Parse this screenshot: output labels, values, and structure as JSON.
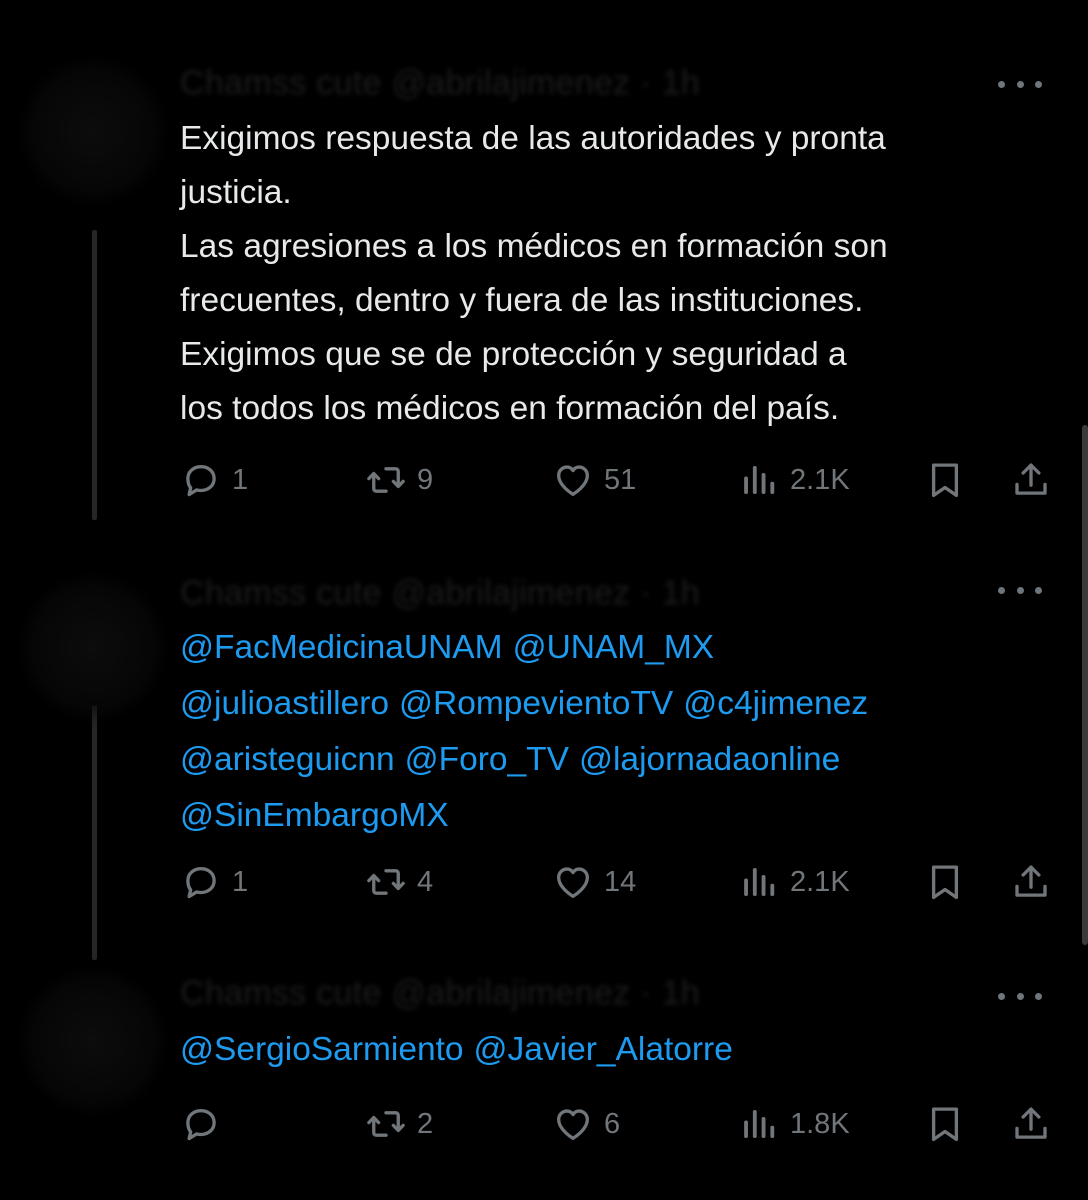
{
  "tweets": [
    {
      "author_line": "Chamss cute @abrilajimenez · 1h",
      "text": "Exigimos respuesta de las autoridades y pronta\njusticia.\nLas agresiones a los médicos en formación son\nfrecuentes, dentro y fuera de las instituciones.\nExigimos que se de protección y seguridad a\nlos todos los médicos en formación del país.",
      "replies": "1",
      "reposts": "9",
      "likes": "51",
      "views": "2.1K"
    },
    {
      "author_line": "Chamss cute @abrilajimenez · 1h",
      "mentions": [
        "@FacMedicinaUNAM",
        "@UNAM_MX",
        "@julioastillero",
        "@RompevientoTV",
        "@c4jimenez",
        "@aristeguicnn",
        "@Foro_TV",
        "@lajornadaonline",
        "@SinEmbargoMX"
      ],
      "replies": "1",
      "reposts": "4",
      "likes": "14",
      "views": "2.1K"
    },
    {
      "author_line": "Chamss cute @abrilajimenez · 1h",
      "mentions": [
        "@SergioSarmiento",
        "@Javier_Alatorre"
      ],
      "replies": "",
      "reposts": "2",
      "likes": "6",
      "views": "1.8K"
    }
  ],
  "icons": {
    "reply": "reply-icon",
    "repost": "repost-icon",
    "like": "heart-icon",
    "views": "views-icon",
    "bookmark": "bookmark-icon",
    "share": "share-icon",
    "more": "more-icon"
  },
  "colors": {
    "background": "#000000",
    "text": "#e7e9ea",
    "link": "#1d9bf0",
    "muted": "#71767b"
  }
}
